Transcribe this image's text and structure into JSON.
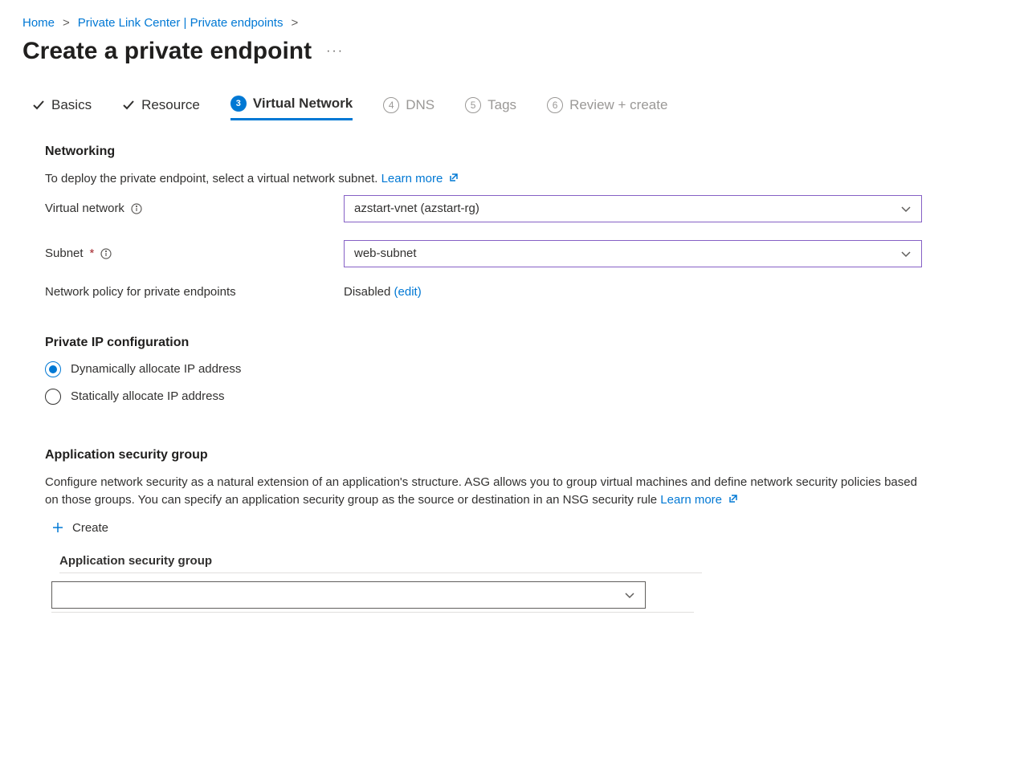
{
  "breadcrumb": {
    "home": "Home",
    "center": "Private Link Center | Private endpoints"
  },
  "page_title": "Create a private endpoint",
  "tabs": {
    "basics": "Basics",
    "resource": "Resource",
    "vnet_num": "3",
    "vnet": "Virtual Network",
    "dns_num": "4",
    "dns": "DNS",
    "tags_num": "5",
    "tags": "Tags",
    "review_num": "6",
    "review": "Review + create"
  },
  "networking": {
    "heading": "Networking",
    "desc": "To deploy the private endpoint, select a virtual network subnet.",
    "learn_more": "Learn more",
    "vnet_label": "Virtual network",
    "vnet_value": "azstart-vnet (azstart-rg)",
    "subnet_label": "Subnet",
    "subnet_value": "web-subnet",
    "policy_label": "Network policy for private endpoints",
    "policy_value": "Disabled",
    "policy_edit": "(edit)"
  },
  "ipconfig": {
    "heading": "Private IP configuration",
    "dynamic": "Dynamically allocate IP address",
    "static": "Statically allocate IP address"
  },
  "asg": {
    "heading": "Application security group",
    "desc": "Configure network security as a natural extension of an application's structure. ASG allows you to group virtual machines and define network security policies based on those groups. You can specify an application security group as the source or destination in an NSG security rule",
    "learn_more": "Learn more",
    "create": "Create",
    "column": "Application security group"
  }
}
